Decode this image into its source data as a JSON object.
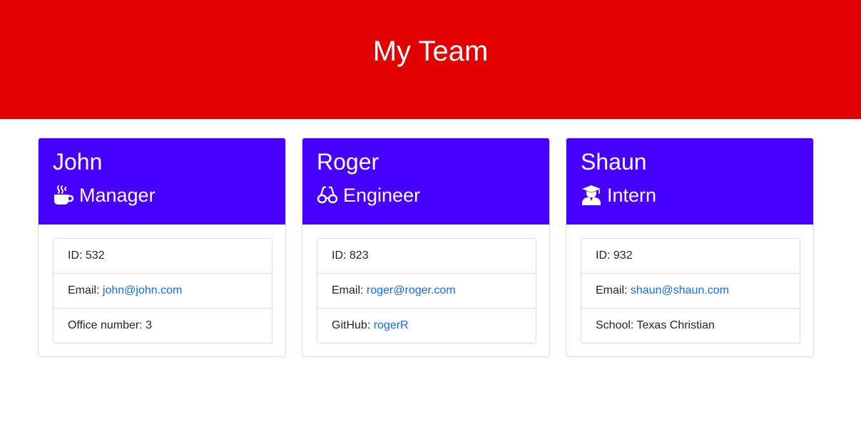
{
  "header": {
    "title": "My Team",
    "background": "#e30000"
  },
  "card_header_color": "#4700ff",
  "link_color": "#0d6efd",
  "team": [
    {
      "name": "John",
      "role": "Manager",
      "role_icon": "mug-hot-icon",
      "id_label": "ID: ",
      "id": "532",
      "email_label": "Email: ",
      "email": "john@john.com",
      "extra_label": "Office number: ",
      "extra_value": "3"
    },
    {
      "name": "Roger",
      "role": "Engineer",
      "role_icon": "glasses-icon",
      "id_label": "ID: ",
      "id": "823",
      "email_label": "Email: ",
      "email": "roger@roger.com",
      "extra_label": "GitHub: ",
      "extra_value": "rogerR"
    },
    {
      "name": "Shaun",
      "role": "Intern",
      "role_icon": "user-graduate-icon",
      "id_label": "ID: ",
      "id": "932",
      "email_label": "Email: ",
      "email": "shaun@shaun.com",
      "extra_label": "School: ",
      "extra_value": "Texas Christian"
    }
  ]
}
